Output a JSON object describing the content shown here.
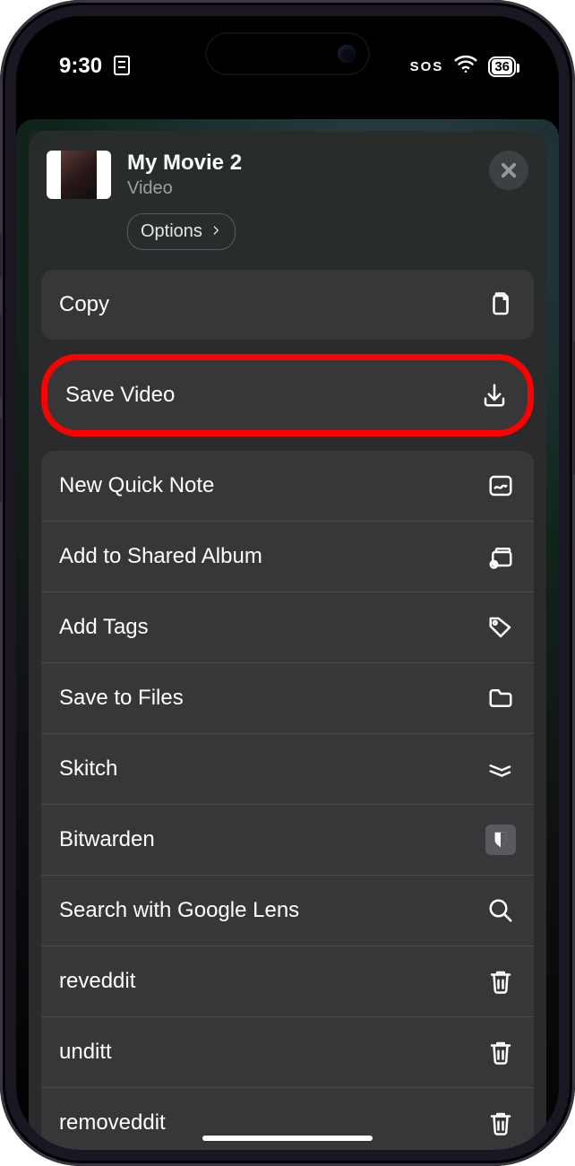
{
  "status": {
    "time": "9:30",
    "sos": "SOS",
    "battery": "36"
  },
  "header": {
    "title": "My Movie 2",
    "subtitle": "Video",
    "options_label": "Options"
  },
  "actions": {
    "copy": "Copy",
    "save_video": "Save Video",
    "new_quick_note": "New Quick Note",
    "add_to_shared_album": "Add to Shared Album",
    "add_tags": "Add Tags",
    "save_to_files": "Save to Files",
    "skitch": "Skitch",
    "bitwarden": "Bitwarden",
    "search_google_lens": "Search with Google Lens",
    "reveddit": "reveddit",
    "unditt": "unditt",
    "removeddit": "removeddit"
  }
}
